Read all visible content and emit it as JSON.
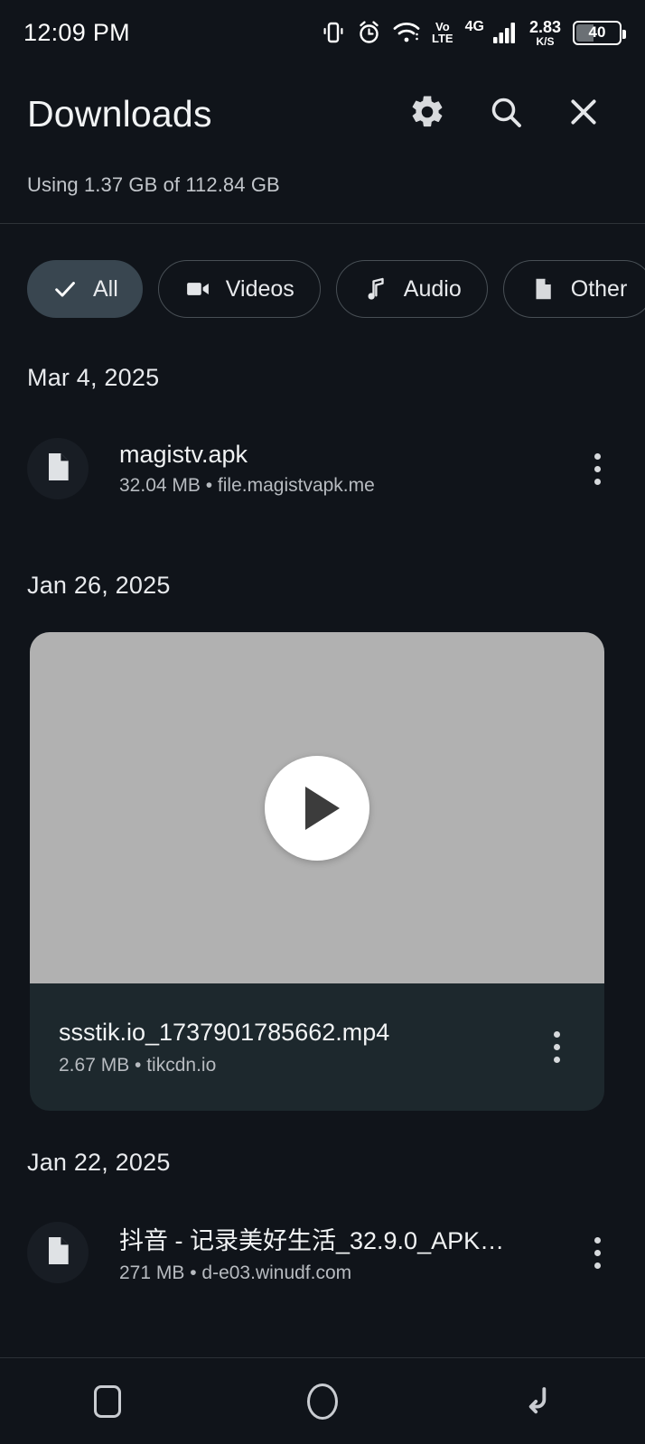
{
  "statusbar": {
    "time": "12:09 PM",
    "icons": [
      "vibrate-icon",
      "alarm-icon",
      "wifi-icon",
      "volte-icon",
      "signal-4g-icon",
      "data-speed",
      "battery-icon"
    ],
    "volte_top": "Vo",
    "volte_bottom": "LTE",
    "network": "4G",
    "data_speed_value": "2.83",
    "data_speed_unit": "K/S",
    "battery_level": "40"
  },
  "header": {
    "title": "Downloads",
    "settings_icon": "gear-icon",
    "search_icon": "search-icon",
    "close_icon": "close-icon",
    "storage": "Using 1.37 GB of 112.84 GB"
  },
  "filters": [
    {
      "label": "All",
      "icon": "check-icon",
      "selected": true
    },
    {
      "label": "Videos",
      "icon": "video-camera-icon",
      "selected": false
    },
    {
      "label": "Audio",
      "icon": "music-note-icon",
      "selected": false
    },
    {
      "label": "Other",
      "icon": "document-icon",
      "selected": false
    }
  ],
  "groups": [
    {
      "date": "Mar 4, 2025",
      "items": [
        {
          "type": "file",
          "name": "magistv.apk",
          "size": "32.04 MB",
          "source": "file.magistvapk.me",
          "subtitle": "32.04 MB • file.magistvapk.me",
          "icon": "document-icon"
        }
      ]
    },
    {
      "date": "Jan 26, 2025",
      "items": [
        {
          "type": "video",
          "name": "ssstik.io_1737901785662.mp4",
          "size": "2.67 MB",
          "source": "tikcdn.io",
          "subtitle": "2.67 MB • tikcdn.io",
          "icon": "play-icon"
        }
      ]
    },
    {
      "date": "Jan 22, 2025",
      "items": [
        {
          "type": "file",
          "name": "抖音 - 记录美好生活_32.9.0_APK…",
          "size": "271 MB",
          "source": "d-e03.winudf.com",
          "subtitle": "271 MB • d-e03.winudf.com",
          "icon": "document-icon"
        }
      ]
    }
  ],
  "navbar": {
    "recents": "recents-square-icon",
    "home": "home-circle-icon",
    "back": "back-arrow-icon"
  },
  "colors": {
    "background": "#10141a",
    "chip_selected": "#394650",
    "text_primary": "#f1f3f4",
    "text_secondary": "#b7bbc0",
    "thumbnail": "#b1b1b1",
    "card_info": "#1d282d"
  }
}
